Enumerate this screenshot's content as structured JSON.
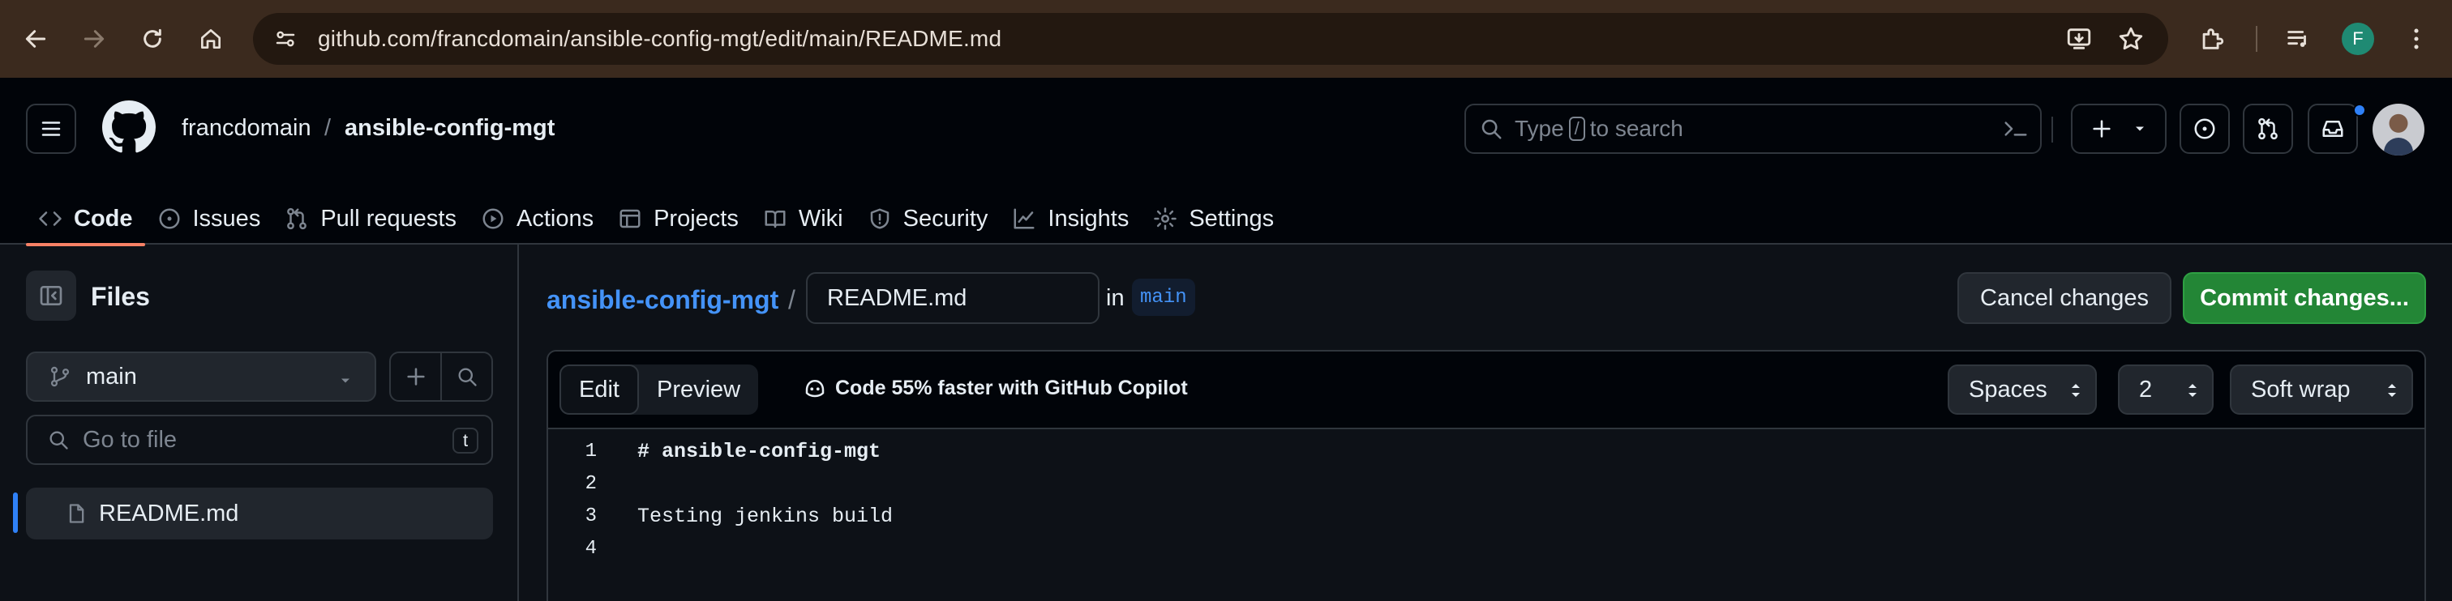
{
  "browser": {
    "url": "github.com/francdomain/ansible-config-mgt/edit/main/README.md",
    "profile_initial": "F"
  },
  "header": {
    "owner": "francdomain",
    "separator": "/",
    "repo": "ansible-config-mgt",
    "search": {
      "prefix": "Type",
      "key": "/",
      "suffix": "to search"
    }
  },
  "repo_nav": {
    "tabs": [
      {
        "label": "Code",
        "icon": "code-icon",
        "active": true
      },
      {
        "label": "Issues",
        "icon": "issue-opened-icon"
      },
      {
        "label": "Pull requests",
        "icon": "git-pull-request-icon"
      },
      {
        "label": "Actions",
        "icon": "play-icon"
      },
      {
        "label": "Projects",
        "icon": "table-icon"
      },
      {
        "label": "Wiki",
        "icon": "book-icon"
      },
      {
        "label": "Security",
        "icon": "shield-icon"
      },
      {
        "label": "Insights",
        "icon": "graph-icon"
      },
      {
        "label": "Settings",
        "icon": "gear-icon"
      }
    ]
  },
  "sidebar": {
    "title": "Files",
    "branch": "main",
    "goto_placeholder": "Go to file",
    "goto_key": "t",
    "files": [
      "README.md"
    ]
  },
  "editor_header": {
    "repo": "ansible-config-mgt",
    "separator": "/",
    "filename": "README.md",
    "in_label": "in",
    "branch": "main",
    "cancel_label": "Cancel changes",
    "commit_label": "Commit changes..."
  },
  "editor": {
    "tabs": [
      "Edit",
      "Preview"
    ],
    "active_tab": "Edit",
    "copilot_text": "Code 55% faster with GitHub Copilot",
    "indent_mode": "Spaces",
    "indent_size": "2",
    "wrap_mode": "Soft wrap",
    "line_numbers": [
      "1",
      "2",
      "3",
      "4"
    ],
    "lines": [
      "# ansible-config-mgt",
      "",
      "Testing jenkins build",
      ""
    ]
  },
  "colors": {
    "accent_tab": "#f78166",
    "link_blue": "#4493f8",
    "commit_green": "#238636",
    "chrome_brown": "#3b2a1e"
  }
}
